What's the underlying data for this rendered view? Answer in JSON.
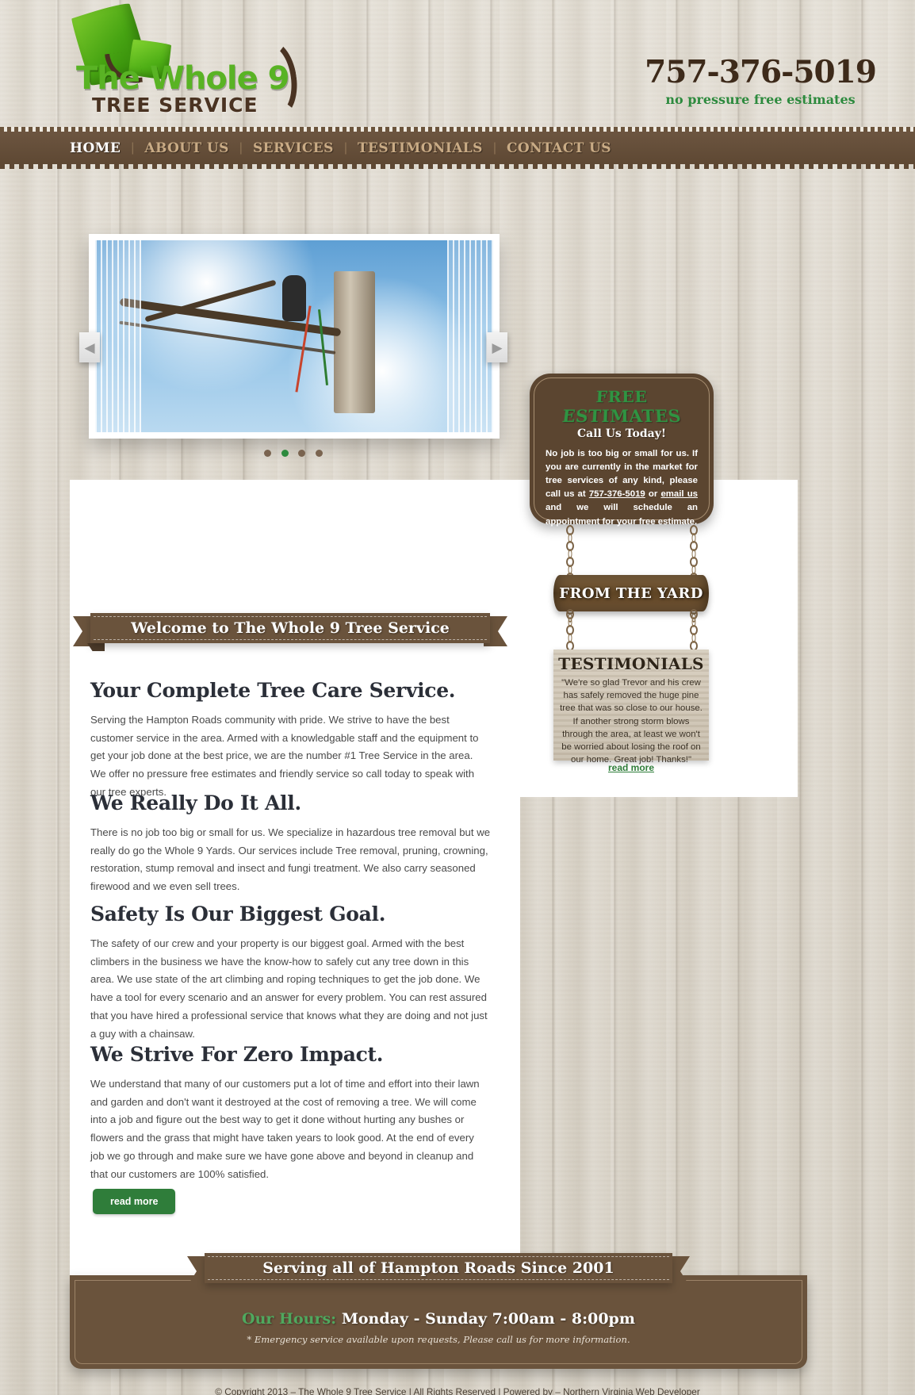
{
  "header": {
    "logo_main": "The Whole 9",
    "logo_sub": "TREE SERVICE",
    "phone": "757-376-5019",
    "phone_tagline": "no pressure free estimates"
  },
  "nav": {
    "items": [
      {
        "label": "HOME",
        "active": true
      },
      {
        "label": "ABOUT US",
        "active": false
      },
      {
        "label": "SERVICES",
        "active": false
      },
      {
        "label": "TESTIMONIALS",
        "active": false
      },
      {
        "label": "CONTACT US",
        "active": false
      }
    ],
    "separator": "|"
  },
  "slider": {
    "prev_icon": "◀",
    "next_icon": "▶",
    "dot_count": 4,
    "active_dot": 1
  },
  "ribbon": {
    "welcome": "Welcome to The Whole 9 Tree Service"
  },
  "main": {
    "sections": [
      {
        "heading": "Your Complete Tree Care Service.",
        "body": "Serving the Hampton Roads community with pride. We strive to have the best customer service in the area. Armed with a knowledgable staff and the equipment to get your job done at the best price, we are the number #1 Tree Service in the area. We offer no pressure free estimates and friendly service so call today to speak with our tree experts."
      },
      {
        "heading": "We Really Do It All.",
        "body": "There is no job too big or small for us. We specialize in hazardous tree removal but we really do go the Whole 9 Yards. Our services include Tree removal, pruning, crowning, restoration, stump removal and insect and fungi treatment. We also carry seasoned firewood and we even sell trees."
      },
      {
        "heading": "Safety Is Our Biggest Goal.",
        "body": "The safety of our crew and your property is our biggest goal. Armed with the best climbers in the business we have the know-how to safely cut any tree down in this area. We use state of the art climbing and roping techniques to get the job done. We have a tool for every scenario and an answer for every problem. You can rest assured that you have hired a professional service that knows what they are doing and not just a guy with a chainsaw."
      },
      {
        "heading": "We Strive For Zero Impact.",
        "body": "We understand that many of our customers put a lot of time and effort into their lawn and garden and don't want it destroyed at the cost of removing a tree. We will come into a job and figure out the best way to get it done without hurting any bushes or flowers and the grass that might have taken years to look good. At the end of every job we go through and make sure we have gone above and beyond in cleanup and that our customers are 100% satisfied."
      }
    ],
    "read_more": "read more"
  },
  "sidebar": {
    "free_estimates_title": "FREE ESTIMATES",
    "call_today": "Call Us Today!",
    "estimate_text_1": "No job is too big or small for us. If you are currently in the market for tree services of any kind, please call us at ",
    "estimate_phone": "757-376-5019",
    "estimate_text_2": " or ",
    "estimate_email": "email us",
    "estimate_text_3": " and we will schedule an appointment for your free estimate.",
    "yard_sign": "FROM THE YARD",
    "testimonials_title": "TESTIMONIALS",
    "testimonial_quote": "\"We're so glad Trevor and his crew has safely removed the huge pine tree that was so close to our house. If another strong storm blows through the area, at least we won't be worried about losing the roof on our home. Great job! Thanks!\"",
    "testimonial_read_more": "read more"
  },
  "footer": {
    "banner": "Serving all of Hampton Roads Since 2001",
    "hours_label": "Our Hours:",
    "hours_value": "Monday - Sunday   7:00am - 8:00pm",
    "hours_note": "* Emergency service available upon requests, Please call us for more information.",
    "copyright_text": "© Copyright 2013 – The Whole 9 Tree Service | All Rights Reserved | Powered by – ",
    "copyright_link": "Northern Virginia Web Developer"
  },
  "colors": {
    "brown": "#6a533c",
    "dark_brown": "#5b4530",
    "green": "#2f7d3a",
    "logo_green": "#59b324",
    "nav_text": "#c9ab85"
  }
}
